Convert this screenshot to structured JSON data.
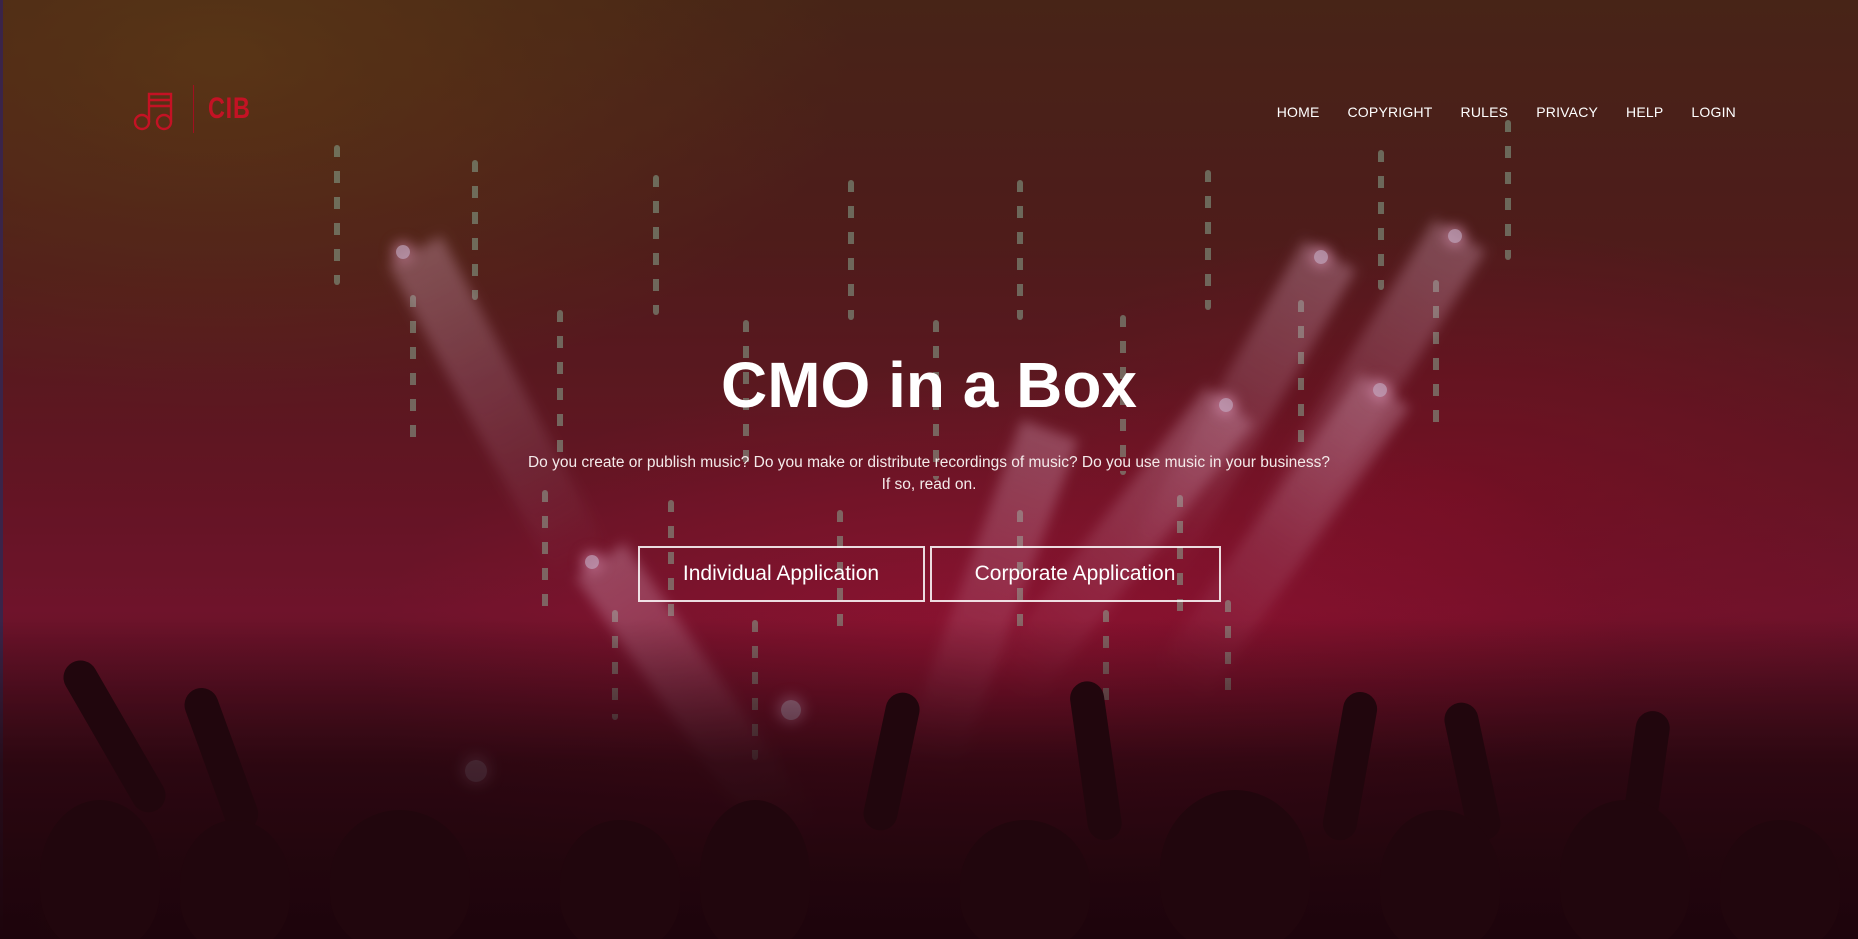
{
  "brand": {
    "logo_text": "CIB",
    "accent_color": "#c41224",
    "icon": "music-notes-icon"
  },
  "nav": {
    "items": [
      {
        "label": "HOME"
      },
      {
        "label": "COPYRIGHT"
      },
      {
        "label": "RULES"
      },
      {
        "label": "PRIVACY"
      },
      {
        "label": "HELP"
      },
      {
        "label": "LOGIN"
      }
    ]
  },
  "hero": {
    "title": "CMO in a Box",
    "subtitle_line1": "Do you create or publish music? Do you make or distribute recordings of music? Do you use music in your business?",
    "subtitle_line2": "If so, read on.",
    "buttons": {
      "individual": "Individual Application",
      "corporate": "Corporate Application"
    }
  }
}
